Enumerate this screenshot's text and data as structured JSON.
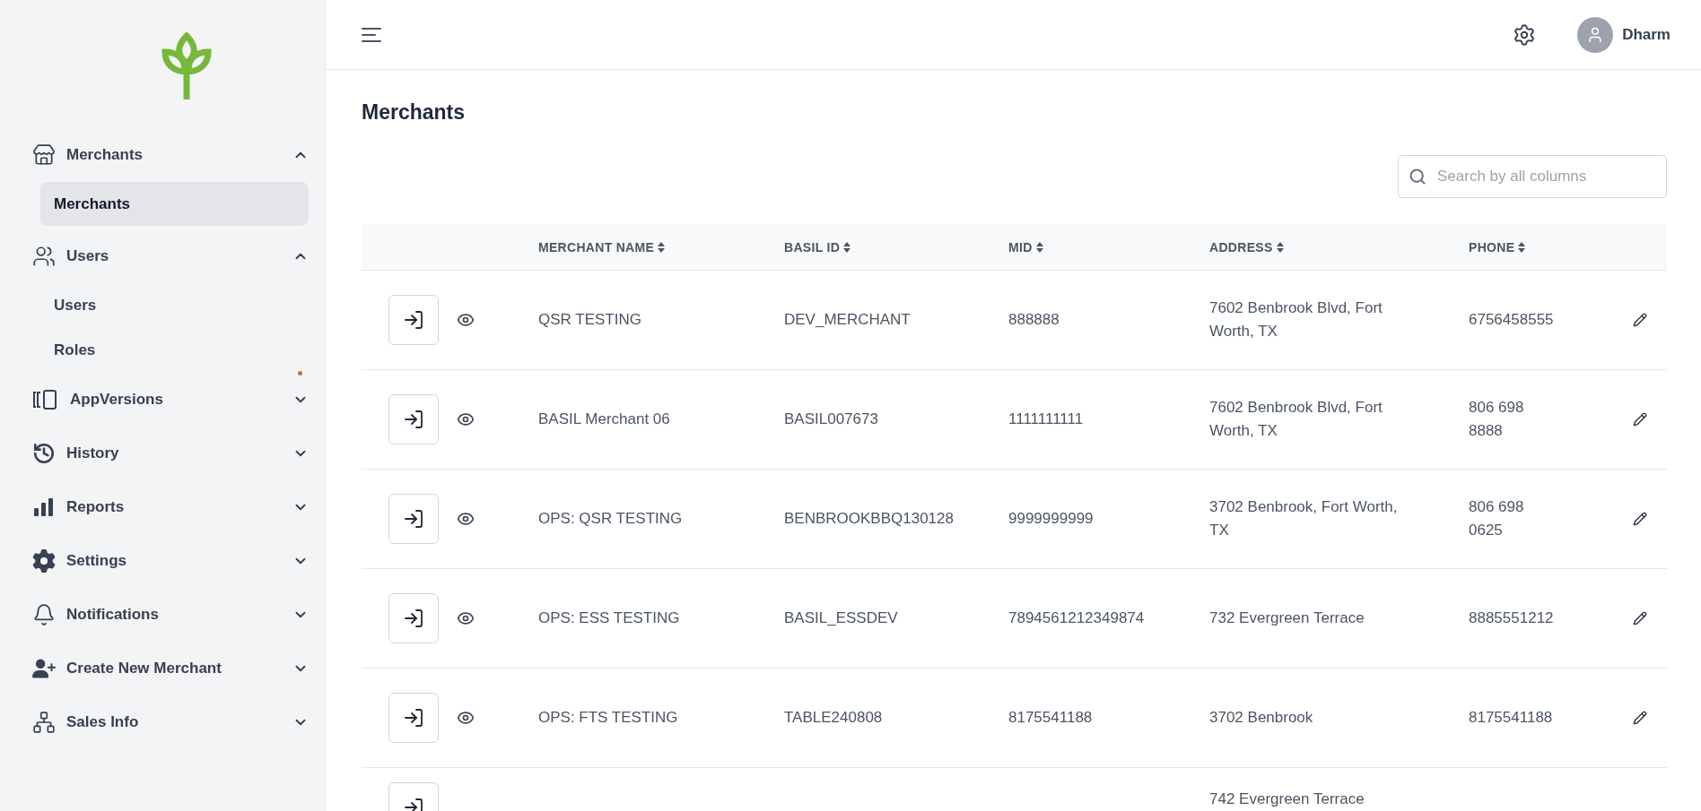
{
  "sidebar": {
    "items": [
      {
        "label": "Merchants",
        "expanded": true,
        "children": [
          {
            "label": "Merchants",
            "selected": true
          }
        ]
      },
      {
        "label": "Users",
        "expanded": true,
        "children": [
          {
            "label": "Users",
            "selected": false
          },
          {
            "label": "Roles",
            "selected": false
          }
        ]
      },
      {
        "label": "AppVersions",
        "expanded": false
      },
      {
        "label": "History",
        "expanded": false
      },
      {
        "label": "Reports",
        "expanded": false
      },
      {
        "label": "Settings",
        "expanded": false
      },
      {
        "label": "Notifications",
        "expanded": false
      },
      {
        "label": "Create New Merchant",
        "expanded": false
      },
      {
        "label": "Sales Info",
        "expanded": false
      }
    ]
  },
  "header": {
    "user_name": "Dharm"
  },
  "page_title": "Merchants",
  "search": {
    "placeholder": "Search by all columns"
  },
  "table": {
    "columns": [
      "MERCHANT NAME",
      "BASIL ID",
      "MID",
      "ADDRESS",
      "PHONE"
    ],
    "rows": [
      {
        "merchant_name": "QSR TESTING",
        "basil_id": "DEV_MERCHANT",
        "mid": "888888",
        "address": "7602 Benbrook Blvd, Fort Worth, TX",
        "phone": "6756458555"
      },
      {
        "merchant_name": "BASIL Merchant 06",
        "basil_id": "BASIL007673",
        "mid": "1111111111",
        "address": "7602 Benbrook Blvd, Fort Worth, TX",
        "phone": "806 698 8888"
      },
      {
        "merchant_name": "OPS: QSR TESTING",
        "basil_id": "BENBROOKBBQ130128",
        "mid": "9999999999",
        "address": "3702 Benbrook, Fort Worth, TX",
        "phone": "806 698 0625"
      },
      {
        "merchant_name": "OPS: ESS TESTING",
        "basil_id": "BASIL_ESSDEV",
        "mid": "7894561212349874",
        "address": "732 Evergreen Terrace",
        "phone": "8885551212"
      },
      {
        "merchant_name": "OPS: FTS TESTING",
        "basil_id": "TABLE240808",
        "mid": "8175541188",
        "address": "3702 Benbrook",
        "phone": "8175541188"
      },
      {
        "address": "742 Evergreen Terrace"
      }
    ]
  }
}
